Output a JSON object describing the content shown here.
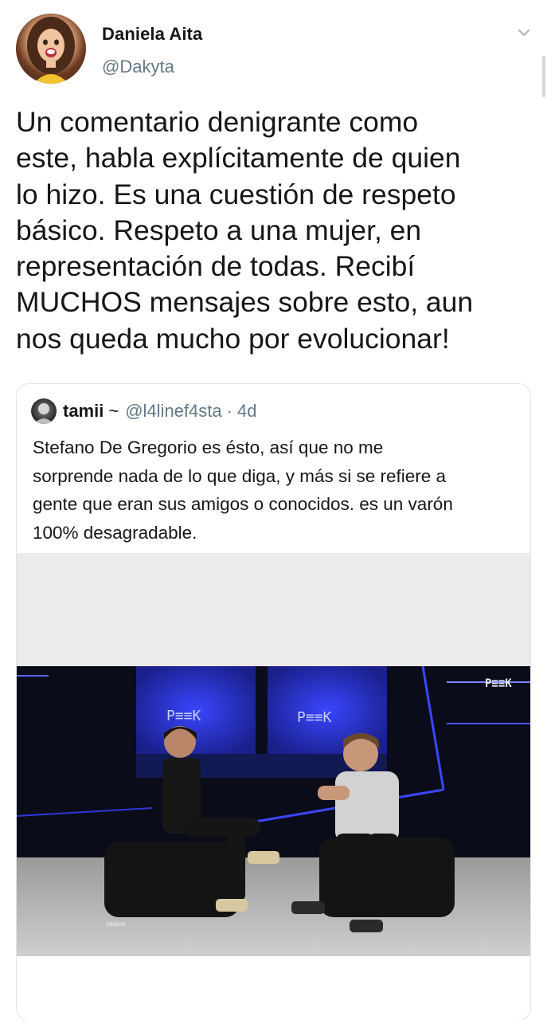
{
  "author": {
    "display_name": "Daniela Aita",
    "handle": "@Dakyta"
  },
  "tweet": {
    "text": "Un comentario denigrante como\neste, habla explícitamente de quien\nlo hizo. Es una cuestión de respeto\nbásico. Respeto a una mujer, en\nrepresentación de todas. Recibí\nMUCHOS mensajes sobre esto, aun\nnos queda mucho por evolucionar!"
  },
  "quoted_tweet": {
    "display_name": "tamii",
    "name_suffix": "~",
    "handle": "@l4linef4sta",
    "separator": "·",
    "time": "4d",
    "text": "Stefano De Gregorio es ésto, así que no me\nsorprende nada de lo que diga, y más si se refiere a\ngente que eran sus amigos o conocidos. es un varón\n100% desagradable.",
    "media": {
      "watermark_top": "P≡≡K",
      "screen_logo": "P≡≡K",
      "corner_mark": "ntdaca"
    }
  },
  "icons": {
    "menu": "chevron-down-icon"
  },
  "colors": {
    "text_primary": "#14171a",
    "text_secondary": "#657786",
    "border": "#dfe5ea",
    "studio_blue": "#2a2fd6"
  }
}
